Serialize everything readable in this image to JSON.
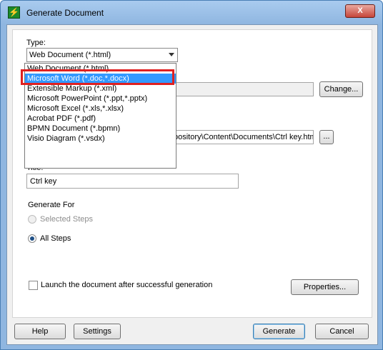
{
  "window": {
    "title": "Generate Document",
    "close_label": "X"
  },
  "type_section": {
    "label": "Type:",
    "selected": "Web Document (*.html)",
    "options": [
      "Web Document (*.html)",
      "Microsoft Word (*.doc,*.docx)",
      "Extensible Markup (*.xml)",
      "Microsoft PowerPoint (*.ppt,*.pptx)",
      "Microsoft Excel (*.xls,*.xlsx)",
      "Acrobat PDF (*.pdf)",
      "BPMN Document (*.bpmn)",
      "Visio Diagram (*.vsdx)"
    ],
    "highlighted_option": "Microsoft Word (*.doc,*.docx)"
  },
  "template": {
    "change_label": "Change..."
  },
  "output": {
    "path_value": "pository\\Content\\Documents\\Ctrl key.htm",
    "browse_label": "..."
  },
  "title_section": {
    "label": "Title:",
    "value": "Ctrl key"
  },
  "generate_for": {
    "label": "Generate For",
    "selected_steps": "Selected Steps",
    "all_steps": "All Steps"
  },
  "launch": {
    "label": "Launch the document after successful generation",
    "properties_label": "Properties..."
  },
  "footer": {
    "help": "Help",
    "settings": "Settings",
    "generate": "Generate",
    "cancel": "Cancel"
  },
  "colors": {
    "selection": "#3399ff",
    "callout": "#e02020"
  }
}
